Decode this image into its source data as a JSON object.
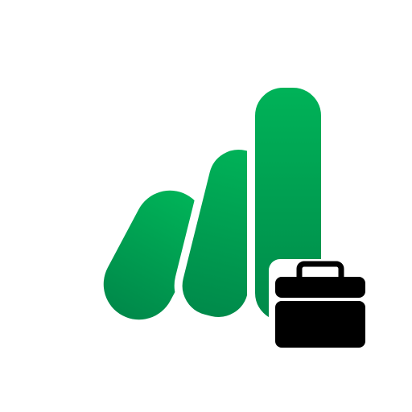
{
  "icon": {
    "name": "finance-app-logo-with-briefcase-badge",
    "bars_icon": "bar-growth-icon",
    "badge_icon": "briefcase-icon"
  },
  "colors": {
    "background": "#ffffff",
    "bar_green_light": "#00b050",
    "bar_green_dark": "#008a45",
    "briefcase": "#000000",
    "briefcase_stripe": "#ffffff"
  }
}
